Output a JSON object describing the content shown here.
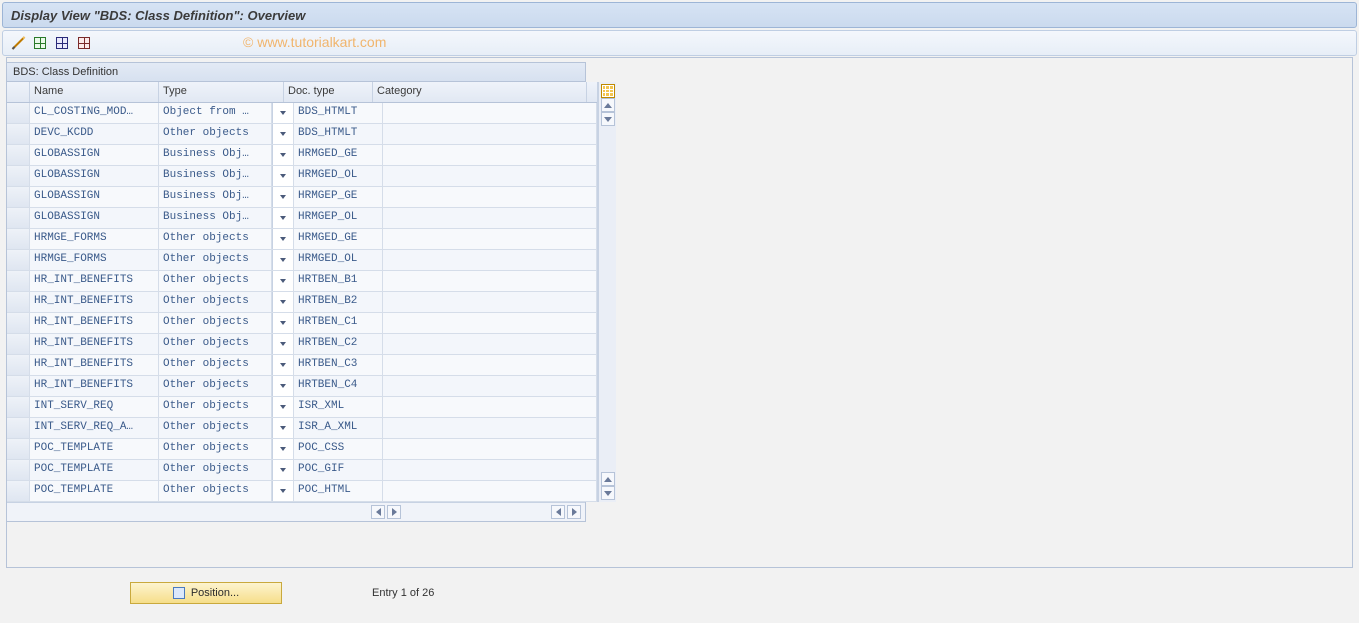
{
  "header": {
    "title": "Display View \"BDS: Class Definition\": Overview"
  },
  "watermark": "© www.tutorialkart.com",
  "panel": {
    "title": "BDS: Class Definition",
    "columns": {
      "name": "Name",
      "type": "Type",
      "doc_type": "Doc. type",
      "category": "Category"
    },
    "rows": [
      {
        "name": "CL_COSTING_MOD…",
        "type": "Object from …",
        "doc": "BDS_HTMLT",
        "cat": ""
      },
      {
        "name": "DEVC_KCDD",
        "type": "Other objects",
        "doc": "BDS_HTMLT",
        "cat": ""
      },
      {
        "name": "GLOBASSIGN",
        "type": "Business Obj…",
        "doc": "HRMGED_GE",
        "cat": ""
      },
      {
        "name": "GLOBASSIGN",
        "type": "Business Obj…",
        "doc": "HRMGED_OL",
        "cat": ""
      },
      {
        "name": "GLOBASSIGN",
        "type": "Business Obj…",
        "doc": "HRMGEP_GE",
        "cat": ""
      },
      {
        "name": "GLOBASSIGN",
        "type": "Business Obj…",
        "doc": "HRMGEP_OL",
        "cat": ""
      },
      {
        "name": "HRMGE_FORMS",
        "type": "Other objects",
        "doc": "HRMGED_GE",
        "cat": ""
      },
      {
        "name": "HRMGE_FORMS",
        "type": "Other objects",
        "doc": "HRMGED_OL",
        "cat": ""
      },
      {
        "name": "HR_INT_BENEFITS",
        "type": "Other objects",
        "doc": "HRTBEN_B1",
        "cat": ""
      },
      {
        "name": "HR_INT_BENEFITS",
        "type": "Other objects",
        "doc": "HRTBEN_B2",
        "cat": ""
      },
      {
        "name": "HR_INT_BENEFITS",
        "type": "Other objects",
        "doc": "HRTBEN_C1",
        "cat": ""
      },
      {
        "name": "HR_INT_BENEFITS",
        "type": "Other objects",
        "doc": "HRTBEN_C2",
        "cat": ""
      },
      {
        "name": "HR_INT_BENEFITS",
        "type": "Other objects",
        "doc": "HRTBEN_C3",
        "cat": ""
      },
      {
        "name": "HR_INT_BENEFITS",
        "type": "Other objects",
        "doc": "HRTBEN_C4",
        "cat": ""
      },
      {
        "name": "INT_SERV_REQ",
        "type": "Other objects",
        "doc": "ISR_XML",
        "cat": ""
      },
      {
        "name": "INT_SERV_REQ_A…",
        "type": "Other objects",
        "doc": "ISR_A_XML",
        "cat": ""
      },
      {
        "name": "POC_TEMPLATE",
        "type": "Other objects",
        "doc": "POC_CSS",
        "cat": ""
      },
      {
        "name": "POC_TEMPLATE",
        "type": "Other objects",
        "doc": "POC_GIF",
        "cat": ""
      },
      {
        "name": "POC_TEMPLATE",
        "type": "Other objects",
        "doc": "POC_HTML",
        "cat": ""
      }
    ]
  },
  "footer": {
    "position_label": "Position...",
    "entry_text": "Entry 1 of 26"
  }
}
